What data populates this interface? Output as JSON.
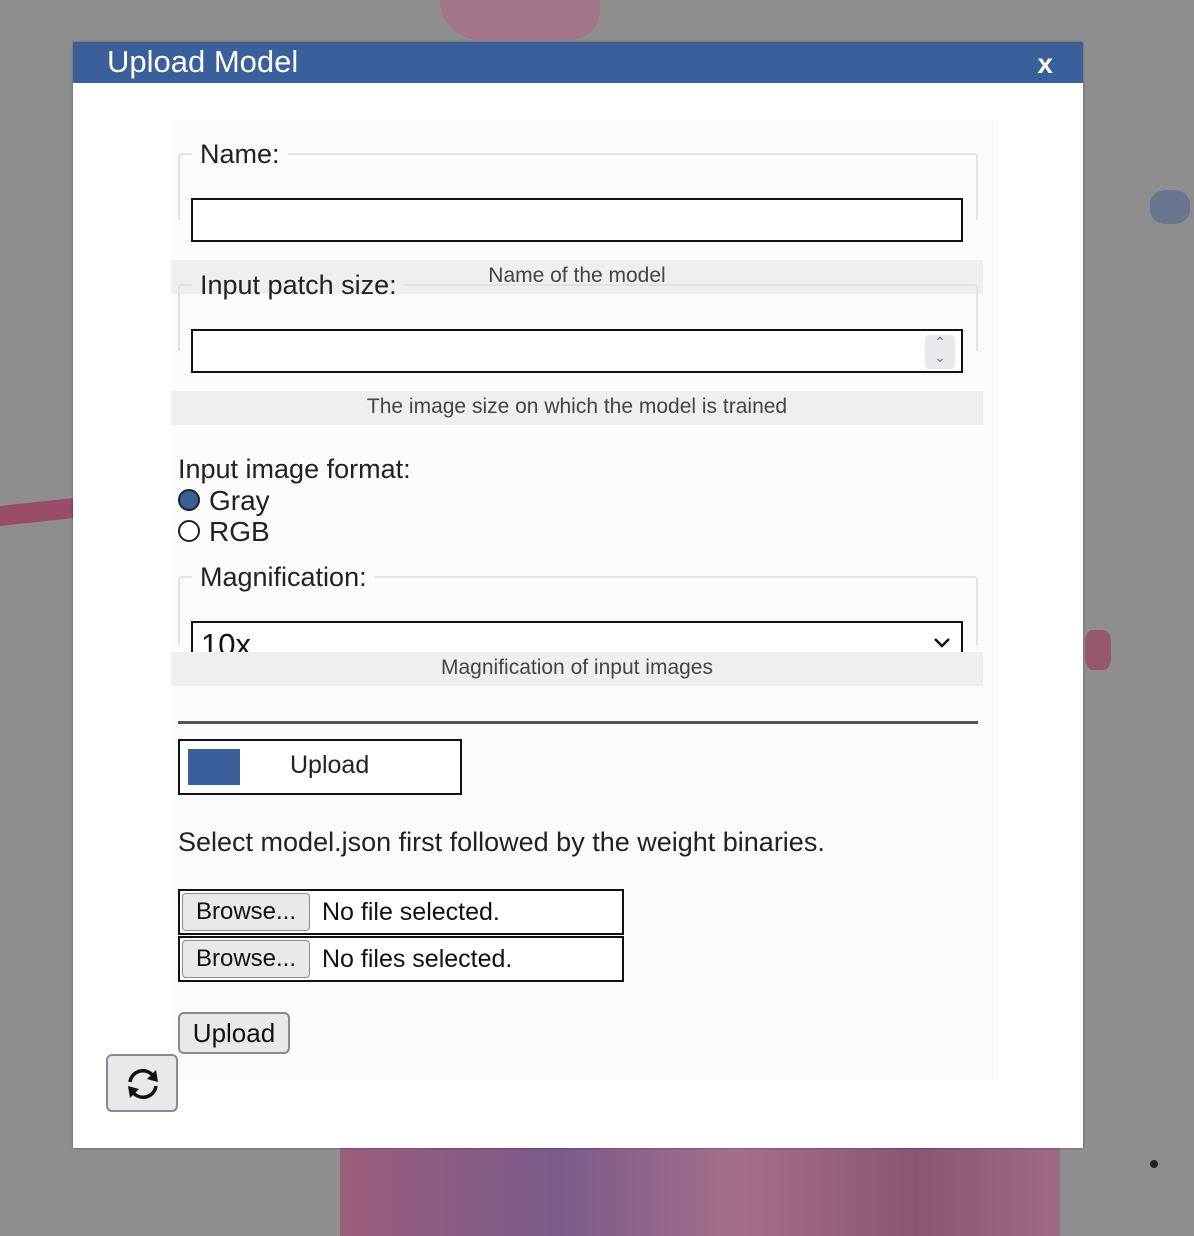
{
  "modal": {
    "title": "Upload Model",
    "close_label": "x"
  },
  "fields": {
    "name": {
      "label": "Name:",
      "value": "",
      "hint": "Name of the model"
    },
    "patch_size": {
      "label": "Input patch size:",
      "value": "",
      "hint": "The image size on which the model is trained"
    },
    "image_format": {
      "label": "Input image format:",
      "options": [
        {
          "label": "Gray",
          "checked": true
        },
        {
          "label": "RGB",
          "checked": false
        }
      ]
    },
    "magnification": {
      "label": "Magnification:",
      "selected": "10x",
      "hint": "Magnification of input images"
    }
  },
  "upload": {
    "toggle_label": "Upload",
    "instructions": "Select model.json first followed by the weight binaries.",
    "files": [
      {
        "button": "Browse...",
        "status": "No file selected."
      },
      {
        "button": "Browse...",
        "status": "No files selected."
      }
    ],
    "submit_label": "Upload"
  },
  "icons": {
    "refresh": "refresh-icon",
    "close": "close-icon"
  },
  "colors": {
    "accent": "#3a5f9a"
  }
}
